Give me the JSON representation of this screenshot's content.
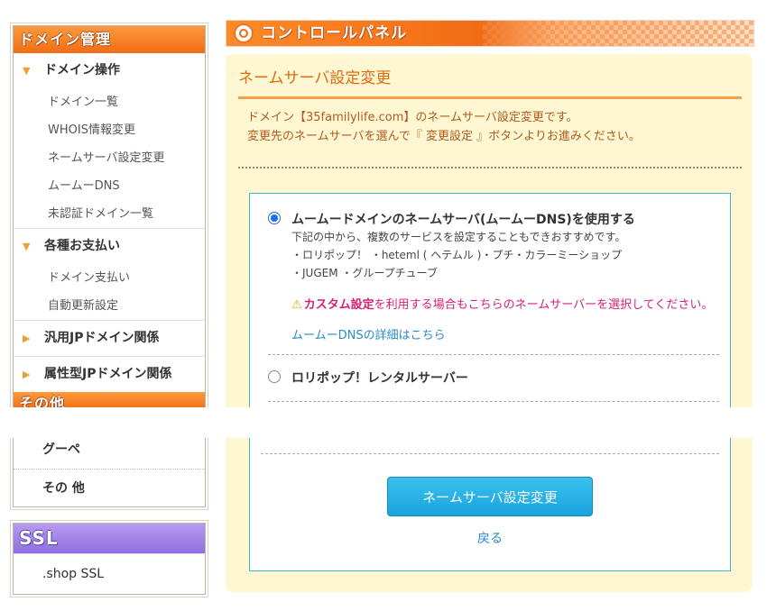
{
  "sidebar": {
    "domain_header": "ドメイン管理",
    "sections": [
      {
        "label": "ドメイン操作",
        "items": [
          "ドメイン一覧",
          "WHOIS情報変更",
          "ネームサーバ設定変更",
          "ムームーDNS",
          "未認証ドメイン一覧"
        ]
      },
      {
        "label": "各種お支払い",
        "items": [
          "ドメイン支払い",
          "自動更新設定"
        ]
      },
      {
        "label": "汎用JPドメイン関係",
        "items": []
      },
      {
        "label": "属性型JPドメイン関係",
        "items": []
      }
    ],
    "other_header": "その他",
    "other_items": [
      "グーペ",
      "その 他"
    ],
    "ssl_header": "SSL",
    "ssl_items": [
      ".shop SSL"
    ]
  },
  "header": {
    "title": "コントロールパネル"
  },
  "main": {
    "title": "ネームサーバ設定変更",
    "intro_line1": "ドメイン【35familylife.com】のネームサーバ設定変更です。",
    "intro_line2": "変更先のネームサーバを選んで『 変更設定 』ボタンよりお進みください。",
    "option1": {
      "label": "ムームードメインのネームサーバ(ムームーDNS)を使用する",
      "desc1": "下記の中から、複数のサービスを設定することもできおすすめです。",
      "desc2": "・ロリポップ！ ・heteml ( ヘテムル )・プチ・カラーミーショップ",
      "desc3": "・JUGEM ・グループチューブ",
      "warn_bold": "カスタム設定",
      "warn_rest": "を利用する場合もこちらのネームサーバーを選択してください。",
      "link": "ムームーDNSの詳細はこちら",
      "selected": true
    },
    "option2": {
      "label": "ロリポップ！レンタルサーバー",
      "selected": false
    },
    "submit_label": "ネームサーバ設定変更",
    "back_label": "戻る"
  },
  "colors": {
    "accent_orange": "#f26c14",
    "panel_bg": "#fff7d2",
    "button_blue": "#19a4de",
    "box_border": "#3fb8c4",
    "warn_pink": "#d4207a"
  }
}
